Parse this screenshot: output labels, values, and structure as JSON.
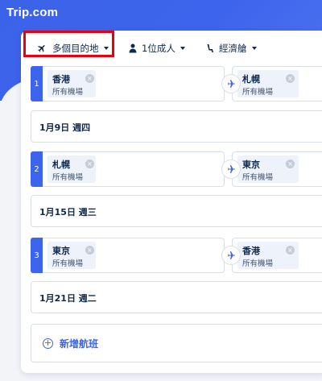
{
  "brand": {
    "logo_text": "Trip.com",
    "accent": "#3d64ec",
    "highlight": "#e8000f"
  },
  "options": {
    "trip_type": {
      "label": "多個目的地",
      "icon": "plane-icon"
    },
    "passengers": {
      "label": "1位成人",
      "icon": "person-icon"
    },
    "cabin": {
      "label": "經濟艙",
      "icon": "seat-icon"
    }
  },
  "legs": [
    {
      "number": "1",
      "from": {
        "city": "香港",
        "sub": "所有機場"
      },
      "to": {
        "city": "札幌",
        "sub": "所有機場"
      },
      "date": "1月9日 週四"
    },
    {
      "number": "2",
      "from": {
        "city": "札幌",
        "sub": "所有機場"
      },
      "to": {
        "city": "東京",
        "sub": "所有機場"
      },
      "date": "1月15日 週三"
    },
    {
      "number": "3",
      "from": {
        "city": "東京",
        "sub": "所有機場"
      },
      "to": {
        "city": "香港",
        "sub": "所有機場"
      },
      "date": "1月21日 週二"
    }
  ],
  "add_flight": {
    "label": "新增航班",
    "icon": "plus-circle-icon"
  }
}
